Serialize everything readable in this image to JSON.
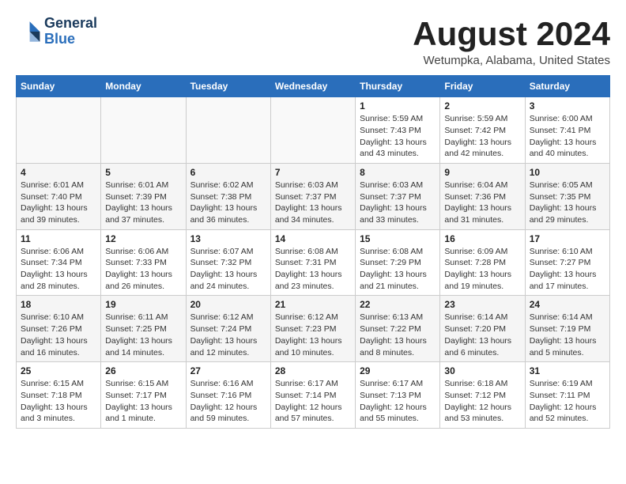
{
  "logo": {
    "line1": "General",
    "line2": "Blue"
  },
  "title": "August 2024",
  "location": "Wetumpka, Alabama, United States",
  "days_of_week": [
    "Sunday",
    "Monday",
    "Tuesday",
    "Wednesday",
    "Thursday",
    "Friday",
    "Saturday"
  ],
  "weeks": [
    [
      {
        "day": "",
        "info": ""
      },
      {
        "day": "",
        "info": ""
      },
      {
        "day": "",
        "info": ""
      },
      {
        "day": "",
        "info": ""
      },
      {
        "day": "1",
        "info": "Sunrise: 5:59 AM\nSunset: 7:43 PM\nDaylight: 13 hours\nand 43 minutes."
      },
      {
        "day": "2",
        "info": "Sunrise: 5:59 AM\nSunset: 7:42 PM\nDaylight: 13 hours\nand 42 minutes."
      },
      {
        "day": "3",
        "info": "Sunrise: 6:00 AM\nSunset: 7:41 PM\nDaylight: 13 hours\nand 40 minutes."
      }
    ],
    [
      {
        "day": "4",
        "info": "Sunrise: 6:01 AM\nSunset: 7:40 PM\nDaylight: 13 hours\nand 39 minutes."
      },
      {
        "day": "5",
        "info": "Sunrise: 6:01 AM\nSunset: 7:39 PM\nDaylight: 13 hours\nand 37 minutes."
      },
      {
        "day": "6",
        "info": "Sunrise: 6:02 AM\nSunset: 7:38 PM\nDaylight: 13 hours\nand 36 minutes."
      },
      {
        "day": "7",
        "info": "Sunrise: 6:03 AM\nSunset: 7:37 PM\nDaylight: 13 hours\nand 34 minutes."
      },
      {
        "day": "8",
        "info": "Sunrise: 6:03 AM\nSunset: 7:37 PM\nDaylight: 13 hours\nand 33 minutes."
      },
      {
        "day": "9",
        "info": "Sunrise: 6:04 AM\nSunset: 7:36 PM\nDaylight: 13 hours\nand 31 minutes."
      },
      {
        "day": "10",
        "info": "Sunrise: 6:05 AM\nSunset: 7:35 PM\nDaylight: 13 hours\nand 29 minutes."
      }
    ],
    [
      {
        "day": "11",
        "info": "Sunrise: 6:06 AM\nSunset: 7:34 PM\nDaylight: 13 hours\nand 28 minutes."
      },
      {
        "day": "12",
        "info": "Sunrise: 6:06 AM\nSunset: 7:33 PM\nDaylight: 13 hours\nand 26 minutes."
      },
      {
        "day": "13",
        "info": "Sunrise: 6:07 AM\nSunset: 7:32 PM\nDaylight: 13 hours\nand 24 minutes."
      },
      {
        "day": "14",
        "info": "Sunrise: 6:08 AM\nSunset: 7:31 PM\nDaylight: 13 hours\nand 23 minutes."
      },
      {
        "day": "15",
        "info": "Sunrise: 6:08 AM\nSunset: 7:29 PM\nDaylight: 13 hours\nand 21 minutes."
      },
      {
        "day": "16",
        "info": "Sunrise: 6:09 AM\nSunset: 7:28 PM\nDaylight: 13 hours\nand 19 minutes."
      },
      {
        "day": "17",
        "info": "Sunrise: 6:10 AM\nSunset: 7:27 PM\nDaylight: 13 hours\nand 17 minutes."
      }
    ],
    [
      {
        "day": "18",
        "info": "Sunrise: 6:10 AM\nSunset: 7:26 PM\nDaylight: 13 hours\nand 16 minutes."
      },
      {
        "day": "19",
        "info": "Sunrise: 6:11 AM\nSunset: 7:25 PM\nDaylight: 13 hours\nand 14 minutes."
      },
      {
        "day": "20",
        "info": "Sunrise: 6:12 AM\nSunset: 7:24 PM\nDaylight: 13 hours\nand 12 minutes."
      },
      {
        "day": "21",
        "info": "Sunrise: 6:12 AM\nSunset: 7:23 PM\nDaylight: 13 hours\nand 10 minutes."
      },
      {
        "day": "22",
        "info": "Sunrise: 6:13 AM\nSunset: 7:22 PM\nDaylight: 13 hours\nand 8 minutes."
      },
      {
        "day": "23",
        "info": "Sunrise: 6:14 AM\nSunset: 7:20 PM\nDaylight: 13 hours\nand 6 minutes."
      },
      {
        "day": "24",
        "info": "Sunrise: 6:14 AM\nSunset: 7:19 PM\nDaylight: 13 hours\nand 5 minutes."
      }
    ],
    [
      {
        "day": "25",
        "info": "Sunrise: 6:15 AM\nSunset: 7:18 PM\nDaylight: 13 hours\nand 3 minutes."
      },
      {
        "day": "26",
        "info": "Sunrise: 6:15 AM\nSunset: 7:17 PM\nDaylight: 13 hours\nand 1 minute."
      },
      {
        "day": "27",
        "info": "Sunrise: 6:16 AM\nSunset: 7:16 PM\nDaylight: 12 hours\nand 59 minutes."
      },
      {
        "day": "28",
        "info": "Sunrise: 6:17 AM\nSunset: 7:14 PM\nDaylight: 12 hours\nand 57 minutes."
      },
      {
        "day": "29",
        "info": "Sunrise: 6:17 AM\nSunset: 7:13 PM\nDaylight: 12 hours\nand 55 minutes."
      },
      {
        "day": "30",
        "info": "Sunrise: 6:18 AM\nSunset: 7:12 PM\nDaylight: 12 hours\nand 53 minutes."
      },
      {
        "day": "31",
        "info": "Sunrise: 6:19 AM\nSunset: 7:11 PM\nDaylight: 12 hours\nand 52 minutes."
      }
    ]
  ]
}
